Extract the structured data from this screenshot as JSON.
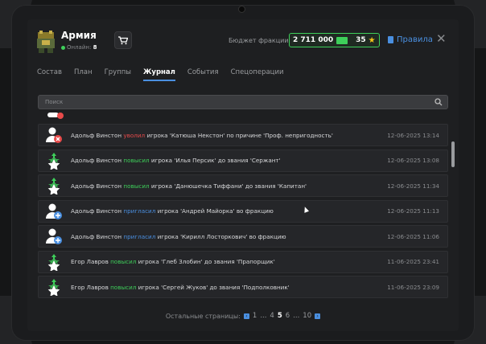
{
  "header": {
    "title": "Армия",
    "online_label": "Онлайн:",
    "online_count": "8",
    "budget_label": "Бюджет фракции:",
    "budget_money": "2 711 000",
    "budget_coins": "35",
    "rules_label": "Правила"
  },
  "tabs": [
    {
      "label": "Состав",
      "active": false
    },
    {
      "label": "План",
      "active": false
    },
    {
      "label": "Группы",
      "active": false
    },
    {
      "label": "Журнал",
      "active": true
    },
    {
      "label": "События",
      "active": false
    },
    {
      "label": "Спецоперации",
      "active": false
    }
  ],
  "search": {
    "placeholder": "Поиск"
  },
  "log": [
    {
      "icon": "user-fired-icon",
      "actor": "Адольф Винстон",
      "action": "уволил",
      "action_color": "red",
      "target_pre": "игрока",
      "rest": "'Катюша Некстон' по причине 'Проф. непригодность'",
      "date": "12-06-2025 13:14"
    },
    {
      "icon": "rank-up-icon",
      "actor": "Адольф Винстон",
      "action": "повысил",
      "action_color": "green",
      "target_pre": "игрока",
      "rest": "'Илья Персик' до звания 'Сержант'",
      "date": "12-06-2025 13:08"
    },
    {
      "icon": "rank-up-icon",
      "actor": "Адольф Винстон",
      "action": "повысил",
      "action_color": "green",
      "target_pre": "игрока",
      "rest": "'Данюшечка Тиффани' до звания 'Капитан'",
      "date": "12-06-2025 11:34"
    },
    {
      "icon": "user-invite-icon",
      "actor": "Адольф Винстон",
      "action": "пригласил",
      "action_color": "blue",
      "target_pre": "игрока",
      "rest": "'Андрей Майорка' во фракцию",
      "date": "12-06-2025 11:13"
    },
    {
      "icon": "user-invite-icon",
      "actor": "Адольф Винстон",
      "action": "пригласил",
      "action_color": "blue",
      "target_pre": "игрока",
      "rest": "'Кирилл Лосторкович' во фракцию",
      "date": "12-06-2025 11:06"
    },
    {
      "icon": "rank-up-icon",
      "actor": "Егор Лавров",
      "action": "повысил",
      "action_color": "green",
      "target_pre": "игрока",
      "rest": "'Глеб Злобин' до звания 'Прапорщик'",
      "date": "11-06-2025 23:41"
    },
    {
      "icon": "rank-up-icon",
      "actor": "Егор Лавров",
      "action": "повысил",
      "action_color": "green",
      "target_pre": "игрока",
      "rest": "'Сергей Жуков' до звания 'Подполковник'",
      "date": "11-06-2025 23:09"
    }
  ],
  "pager": {
    "label": "Остальные страницы:",
    "pages": [
      "1",
      "...",
      "4",
      "5",
      "6",
      "...",
      "10"
    ],
    "current": "5"
  },
  "colors": {
    "accent": "#4a8fe0",
    "green": "#3ecf5a",
    "red": "#e84a4a",
    "gold": "#f5c518"
  }
}
